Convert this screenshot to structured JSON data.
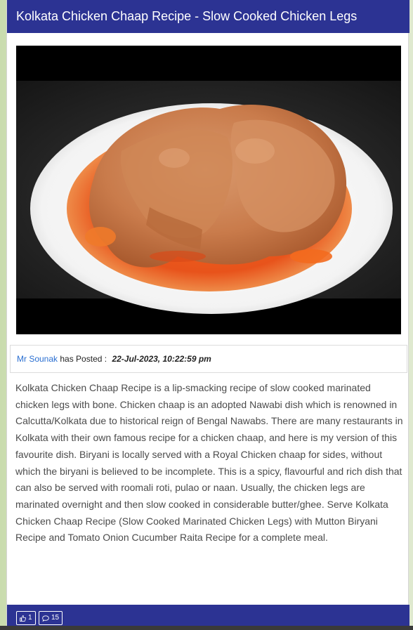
{
  "post": {
    "title": "Kolkata Chicken Chaap Recipe - Slow Cooked Chicken Legs",
    "image_alt": "Kolkata Chicken Chaap in a white plate",
    "author": "Mr Sounak",
    "posted_label": "has Posted :",
    "posted_date": "22-Jul-2023, 10:22:59 pm",
    "description": "Kolkata Chicken Chaap Recipe is a lip-smacking recipe of slow cooked marinated chicken legs with bone. Chicken chaap is an adopted Nawabi dish which is renowned in Calcutta/Kolkata due to historical reign of Bengal Nawabs. There are many restaurants in Kolkata with their own famous recipe for a chicken chaap, and here is my version of this favourite dish. Biryani is locally served with a Royal Chicken chaap for sides, without which the biryani is believed to be incomplete. This is a spicy, flavourful and rich dish that can also be served with roomali roti, pulao or naan. Usually, the chicken legs are marinated overnight and then slow cooked in considerable butter/ghee. Serve Kolkata Chicken Chaap Recipe (Slow Cooked Marinated Chicken Legs) with Mutton Biryani Recipe and Tomato Onion Cucumber Raita Recipe for a complete meal."
  },
  "footer": {
    "likes_icon": "thumbs-up-icon",
    "likes_count": "1",
    "comments_icon": "comment-icon",
    "comments_count": "15"
  },
  "colors": {
    "header_bar": "#2c3393",
    "author_link": "#2a6fd1",
    "body_text": "#4b4b4b",
    "gravy": "#e8531b"
  }
}
